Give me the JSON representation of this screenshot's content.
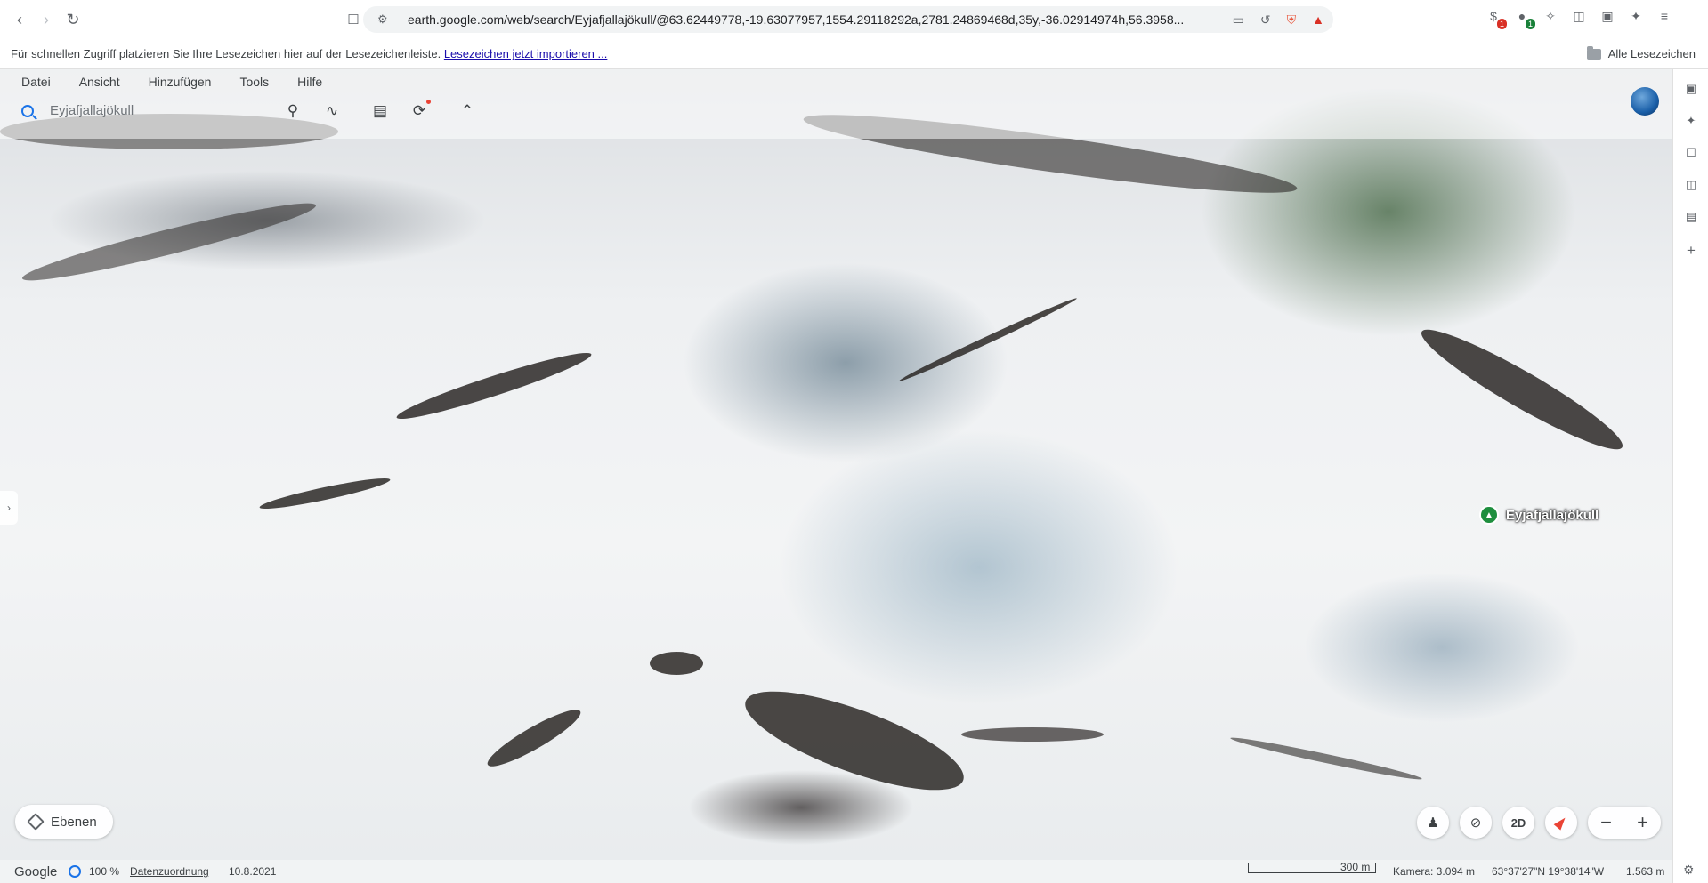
{
  "browser": {
    "url": "earth.google.com/web/search/Eyjafjallajökull/@63.62449778,-19.63077957,1554.29118292a,2781.24869468d,35y,-36.02914974h,56.3958...",
    "ext_badge_1": "1",
    "ext_badge_2": "1"
  },
  "bookmarks": {
    "hint": "Für schnellen Zugriff platzieren Sie Ihre Lesezeichen hier auf der Lesezeichenleiste.",
    "import_link": "Lesezeichen jetzt importieren ...",
    "all_bookmarks": "Alle Lesezeichen"
  },
  "menu": {
    "items": [
      "Datei",
      "Ansicht",
      "Hinzufügen",
      "Tools",
      "Hilfe"
    ]
  },
  "search": {
    "query": "Eyjafjallajökull"
  },
  "placemark": {
    "label": "Eyjafjallajökull"
  },
  "controls": {
    "layers_label": "Ebenen",
    "view_2d": "2D",
    "zoom_out": "−",
    "zoom_in": "+"
  },
  "status": {
    "brand": "Google",
    "load_percent": "100 %",
    "attribution": "Datenzuordnung",
    "date": "10.8.2021",
    "scale": "300 m",
    "camera": "Kamera: 3.094 m",
    "coordinates": "63°37'27\"N 19°38'14\"W",
    "elevation": "1.563 m"
  },
  "colors": {
    "accent": "#1a73e8",
    "placemark": "#1e8e3e",
    "compass": "#ea4335"
  },
  "icons": [
    "back-icon",
    "forward-icon",
    "reload-icon",
    "bookmark-icon",
    "site-settings-icon",
    "cast-icon",
    "share-icon",
    "brave-shield-icon",
    "brave-rewards-icon",
    "extensions-icon",
    "search-icon",
    "placemark-icon",
    "path-icon",
    "ruler-icon",
    "history-icon",
    "collapse-icon",
    "globe-icon",
    "layers-icon",
    "pegman-icon",
    "reset-tilt-icon",
    "compass-icon",
    "gear-icon"
  ]
}
